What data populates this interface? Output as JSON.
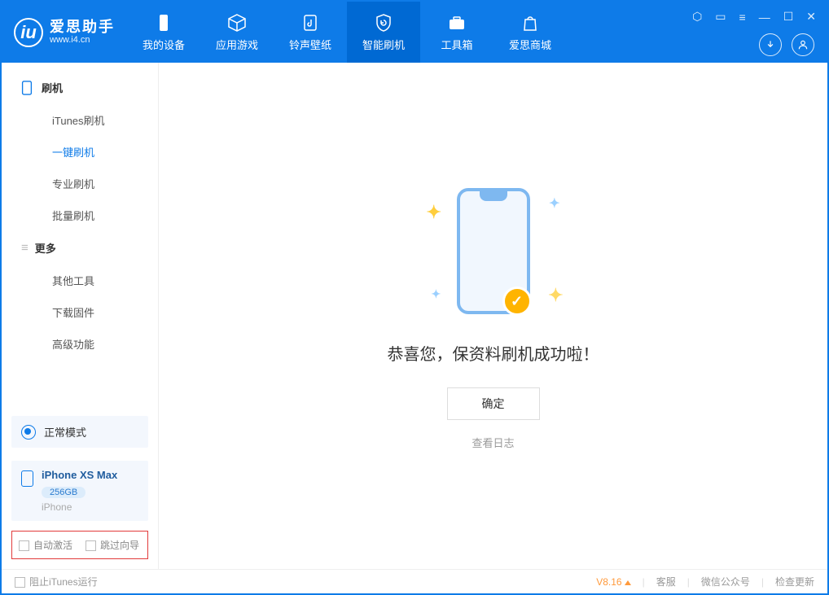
{
  "app": {
    "title": "爱思助手",
    "subtitle": "www.i4.cn"
  },
  "nav": {
    "tabs": [
      {
        "label": "我的设备"
      },
      {
        "label": "应用游戏"
      },
      {
        "label": "铃声壁纸"
      },
      {
        "label": "智能刷机"
      },
      {
        "label": "工具箱"
      },
      {
        "label": "爱思商城"
      }
    ]
  },
  "sidebar": {
    "section_flash": "刷机",
    "items_flash": [
      {
        "label": "iTunes刷机"
      },
      {
        "label": "一键刷机"
      },
      {
        "label": "专业刷机"
      },
      {
        "label": "批量刷机"
      }
    ],
    "section_more": "更多",
    "items_more": [
      {
        "label": "其他工具"
      },
      {
        "label": "下载固件"
      },
      {
        "label": "高级功能"
      }
    ],
    "mode": "正常模式",
    "device": {
      "name": "iPhone XS Max",
      "storage": "256GB",
      "type": "iPhone"
    },
    "opt_auto_activate": "自动激活",
    "opt_skip_guide": "跳过向导"
  },
  "main": {
    "success": "恭喜您，保资料刷机成功啦！",
    "ok_button": "确定",
    "log_link": "查看日志"
  },
  "footer": {
    "block_itunes": "阻止iTunes运行",
    "version": "V8.16",
    "link_service": "客服",
    "link_wechat": "微信公众号",
    "link_update": "检查更新"
  }
}
